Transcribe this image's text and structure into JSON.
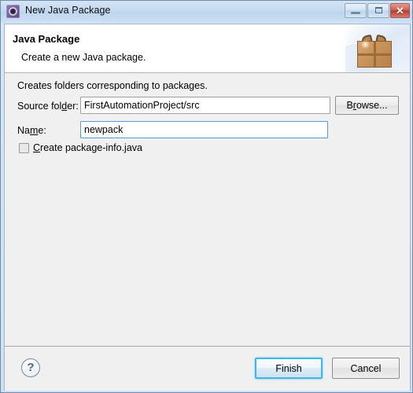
{
  "window": {
    "title": "New Java Package",
    "icon": "java-package-icon",
    "controls": {
      "minimize": "minimize-button",
      "maximize": "maximize-button",
      "close_glyph": "✕"
    }
  },
  "header": {
    "title": "Java Package",
    "description": "Create a new Java package.",
    "art": "gift-box-illustration"
  },
  "content": {
    "intro_text": "Creates folders corresponding to packages.",
    "source_folder": {
      "label_pre": "Source fol",
      "label_mnemonic": "d",
      "label_post": "er:",
      "value": "FirstAutomationProject/src",
      "placeholder": ""
    },
    "browse_button": {
      "label_pre": "B",
      "label_mnemonic": "r",
      "label_post": "owse..."
    },
    "name": {
      "label_pre": "Na",
      "label_mnemonic": "m",
      "label_post": "e:",
      "value": "newpack",
      "placeholder": ""
    },
    "create_package_info": {
      "checked": false,
      "label_pre": "",
      "label_mnemonic": "C",
      "label_post": "reate package-info.java"
    }
  },
  "footer": {
    "help_glyph": "?",
    "finish_label": "Finish",
    "cancel_label": "Cancel"
  },
  "colors": {
    "accent": "#3fb8e8",
    "titlebar": "#c5daf0",
    "panel": "#f0f0f0",
    "close_button": "#b83d2c"
  }
}
